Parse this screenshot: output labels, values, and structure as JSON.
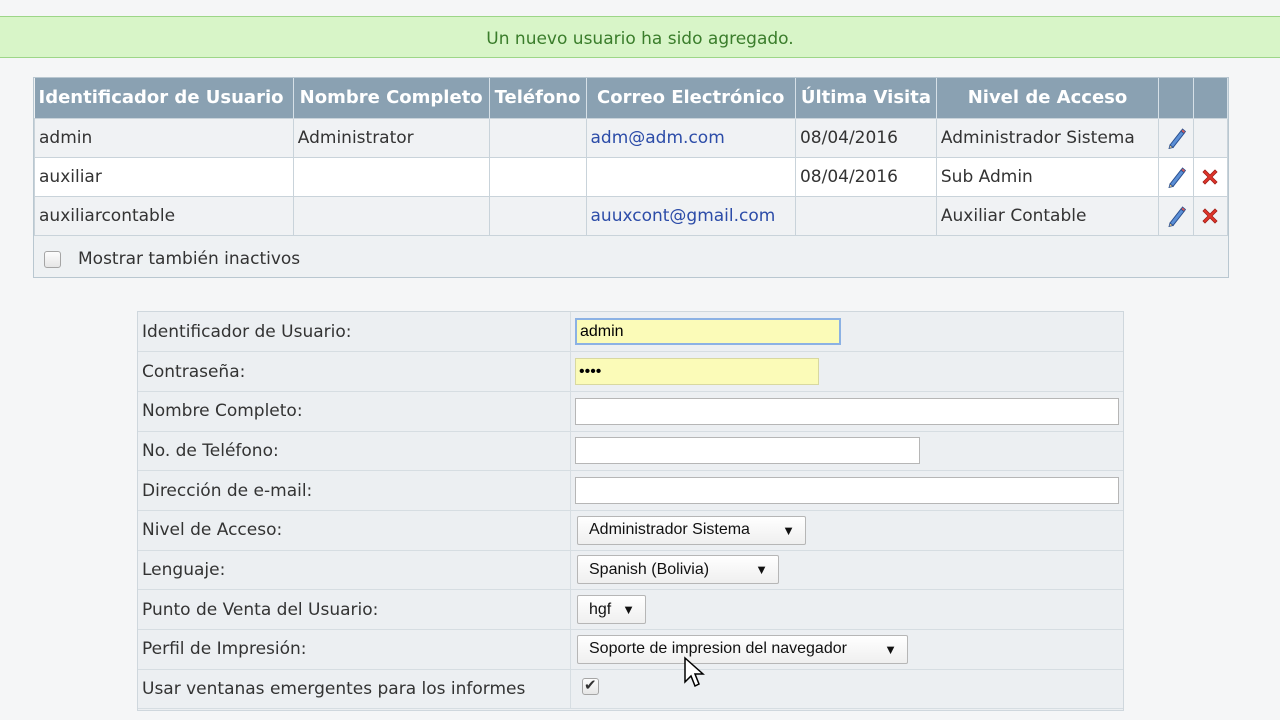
{
  "banner": {
    "message": "Un nuevo usuario ha sido agregado."
  },
  "users_table": {
    "headers": [
      "Identificador de Usuario",
      "Nombre Completo",
      "Teléfono",
      "Correo Electrónico",
      "Última Visita",
      "Nivel de Acceso"
    ],
    "rows": [
      {
        "id": "admin",
        "name": "Administrator",
        "phone": "",
        "email": "adm@adm.com",
        "last_visit": "08/04/2016",
        "access": "Administrador Sistema",
        "editable": true,
        "deletable": false
      },
      {
        "id": "auxiliar",
        "name": "",
        "phone": "",
        "email": "",
        "last_visit": "08/04/2016",
        "access": "Sub Admin",
        "editable": true,
        "deletable": true
      },
      {
        "id": "auxiliarcontable",
        "name": "",
        "phone": "",
        "email": "auuxcont@gmail.com",
        "last_visit": "",
        "access": "Auxiliar Contable",
        "editable": true,
        "deletable": true
      }
    ],
    "show_inactive_label": "Mostrar también inactivos"
  },
  "form": {
    "user_id_label": "Identificador de Usuario:",
    "user_id_value": "admin",
    "password_label": "Contraseña:",
    "password_value": "••••",
    "full_name_label": "Nombre Completo:",
    "full_name_value": "",
    "phone_label": "No. de Teléfono:",
    "phone_value": "",
    "email_label": "Dirección de e-mail:",
    "email_value": "",
    "access_label": "Nivel de Acceso:",
    "access_value": "Administrador Sistema",
    "language_label": "Lenguaje:",
    "language_value": "Spanish (Bolivia)",
    "pos_label": "Punto de Venta del Usuario:",
    "pos_value": "hgf",
    "print_label": "Perfil de Impresión:",
    "print_value": "Soporte de impresion del navegador",
    "popups_label": "Usar ventanas emergentes para los informes",
    "popups_checked": true
  },
  "colors": {
    "banner_bg": "#d8f5c8",
    "banner_text": "#3a7d2b",
    "header_bg": "#8aa1b2",
    "link": "#2c4ca8",
    "delete": "#e0352b"
  }
}
